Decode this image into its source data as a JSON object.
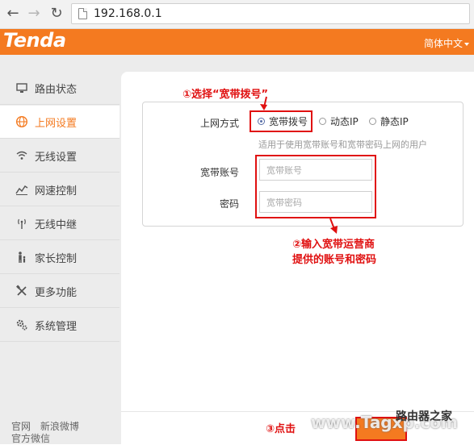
{
  "browser": {
    "url": "192.168.0.1"
  },
  "header": {
    "logo": "Tenda",
    "language": "简体中文"
  },
  "sidebar": {
    "items": [
      {
        "label": "路由状态",
        "icon": "monitor-icon"
      },
      {
        "label": "上网设置",
        "icon": "globe-icon",
        "active": true
      },
      {
        "label": "无线设置",
        "icon": "wifi-icon"
      },
      {
        "label": "网速控制",
        "icon": "speed-icon"
      },
      {
        "label": "无线中继",
        "icon": "antenna-icon"
      },
      {
        "label": "家长控制",
        "icon": "parent-icon"
      },
      {
        "label": "更多功能",
        "icon": "tools-icon"
      },
      {
        "label": "系统管理",
        "icon": "gears-icon"
      }
    ],
    "footer": [
      "官网",
      "新浪微博",
      "官方微信"
    ]
  },
  "form": {
    "connection_label": "上网方式",
    "options": [
      {
        "label": "宽带拨号",
        "selected": true
      },
      {
        "label": "动态IP",
        "selected": false
      },
      {
        "label": "静态IP",
        "selected": false
      }
    ],
    "hint": "适用于使用宽带账号和宽带密码上网的用户",
    "account_label": "宽带账号",
    "account_placeholder": "宽带账号",
    "password_label": "密码",
    "password_placeholder": "宽带密码"
  },
  "annotations": {
    "step1": "①选择“宽带拨号”",
    "step2_line1": "②输入宽带运营商",
    "step2_line2": "提供的账号和密码",
    "step3": "③点击"
  },
  "watermark": "www.Tagxp.com",
  "watermark2": "路由器之家",
  "colors": {
    "brand_orange": "#f47a20",
    "annotation_red": "#e01010"
  }
}
